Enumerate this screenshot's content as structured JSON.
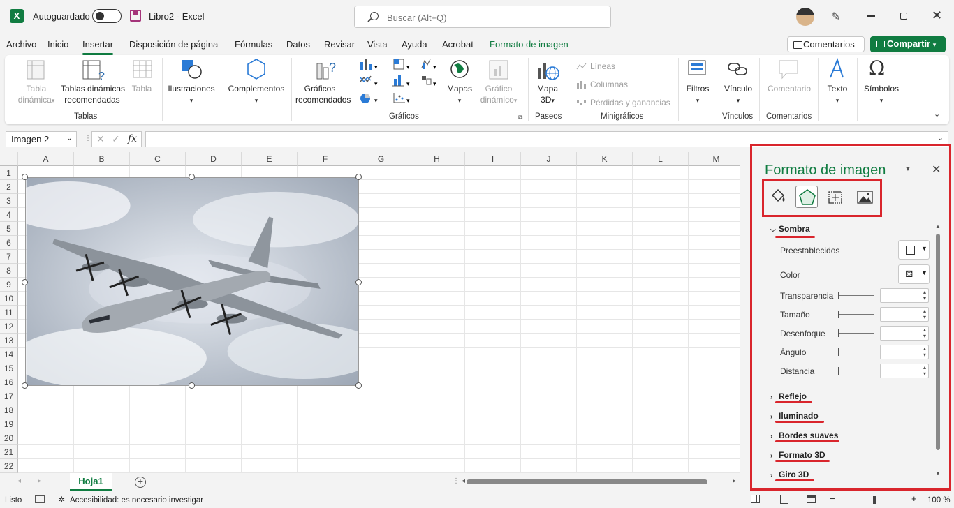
{
  "titlebar": {
    "autosave_label": "Autoguardado",
    "doc_title": "Libro2  -  Excel",
    "search_placeholder": "Buscar (Alt+Q)"
  },
  "tabs": [
    "Archivo",
    "Inicio",
    "Insertar",
    "Disposición de página",
    "Fórmulas",
    "Datos",
    "Revisar",
    "Vista",
    "Ayuda",
    "Acrobat",
    "Formato de imagen"
  ],
  "active_tab": "Insertar",
  "actions": {
    "comments": "Comentarios",
    "share": "Compartir"
  },
  "ribbon": {
    "tabla_dinamica": [
      "Tabla",
      "dinámica"
    ],
    "tablas_recomendadas": [
      "Tablas dinámicas",
      "recomendadas"
    ],
    "tabla": "Tabla",
    "ilustraciones": "Ilustraciones",
    "complementos": "Complementos",
    "graficos_recomendados": [
      "Gráficos",
      "recomendados"
    ],
    "mapas": "Mapas",
    "grafico_dinamico": [
      "Gráfico",
      "dinámico"
    ],
    "mapa3d": [
      "Mapa",
      "3D"
    ],
    "lineas": "Líneas",
    "columnas": "Columnas",
    "perdidas": "Pérdidas y ganancias",
    "filtros": "Filtros",
    "vinculo": "Vínculo",
    "comentario": "Comentario",
    "texto": "Texto",
    "simbolos": "Símbolos",
    "groups": {
      "tablas": "Tablas",
      "graficos": "Gráficos",
      "paseos": "Paseos",
      "minigraficos": "Minigráficos",
      "vinculos": "Vínculos",
      "comentarios": "Comentarios"
    }
  },
  "formula_bar": {
    "name_box": "Imagen 2",
    "fx": "fx",
    "formula": ""
  },
  "columns": [
    "A",
    "B",
    "C",
    "D",
    "E",
    "F",
    "G",
    "H",
    "I",
    "J",
    "K",
    "L",
    "M"
  ],
  "rows": [
    "1",
    "2",
    "3",
    "4",
    "5",
    "6",
    "7",
    "8",
    "9",
    "10",
    "11",
    "12",
    "13",
    "14",
    "15",
    "16",
    "17",
    "18",
    "19",
    "20",
    "21",
    "22"
  ],
  "sheet": {
    "tab": "Hoja1"
  },
  "status": {
    "mode": "Listo",
    "accessibility": "Accesibilidad: es necesario investigar",
    "zoom": "100 %"
  },
  "pane": {
    "title": "Formato de imagen",
    "sections_top": {
      "sombra": "Sombra"
    },
    "props": {
      "preestablecidos": "Preestablecidos",
      "color": "Color",
      "transparencia": "Transparencia",
      "tamano": "Tamaño",
      "desenfoque": "Desenfoque",
      "angulo": "Ángulo",
      "distancia": "Distancia"
    },
    "sections": {
      "reflejo": "Reflejo",
      "iluminado": "Iluminado",
      "bordes": "Bordes suaves",
      "formato3d": "Formato 3D",
      "giro3d": "Giro 3D"
    }
  },
  "colors": {
    "accent": "#107c41",
    "highlight": "#d9252c"
  }
}
